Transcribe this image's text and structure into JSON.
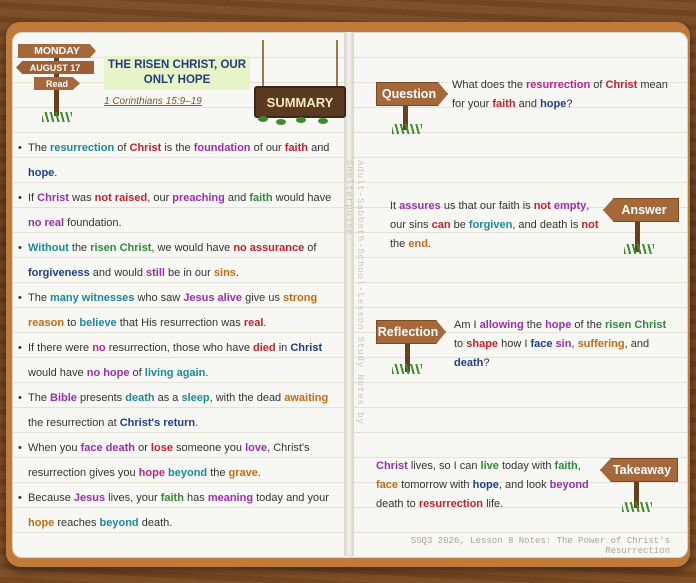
{
  "header": {
    "day": "MONDAY",
    "date": "AUGUST 17",
    "read": "Read",
    "title_line1": "THE RISEN CHRIST, OUR",
    "title_line2": "ONLY HOPE",
    "scripture": "1 Corinthians 15:9–19",
    "summary": "SUMMARY"
  },
  "summary_points": [
    [
      "The ",
      "resurrection",
      " of ",
      "Christ",
      " is the ",
      "foundation",
      " of our ",
      "faith",
      " and ",
      "hope",
      "."
    ],
    [
      "If ",
      "Christ",
      " was ",
      "not raised",
      ", our ",
      "preaching",
      " and ",
      "faith",
      " would have ",
      "no real",
      " foundation."
    ],
    [
      "",
      "Without",
      " the ",
      "risen Christ",
      ", we would have ",
      "no assurance",
      " of ",
      "forgiveness",
      " and would ",
      "still",
      " be in our ",
      "sins",
      "."
    ],
    [
      "The ",
      "many witnesses",
      " who saw ",
      "Jesus alive",
      " give us ",
      "strong reason",
      " to ",
      "believe",
      " that His resurrection was ",
      "real",
      "."
    ],
    [
      "If there were ",
      "no",
      " resurrection, those who have ",
      "died",
      " in ",
      "Christ",
      " would have ",
      "no hope",
      " of ",
      "living again",
      "."
    ],
    [
      "The ",
      "Bible",
      " presents ",
      "death",
      " as a ",
      "sleep",
      ", with the dead ",
      "awaiting",
      " the resurrection at ",
      "Christ's return",
      "."
    ],
    [
      "When you ",
      "face death",
      " or ",
      "lose",
      " someone you ",
      "love",
      ", Christ's resurrection gives you ",
      "hope",
      " ",
      "beyond",
      " the ",
      "grave",
      "."
    ],
    [
      "Because ",
      "Jesus",
      " lives, your ",
      "faith",
      " has ",
      "meaning",
      " today and your ",
      "hope",
      " reaches ",
      "beyond",
      " death."
    ]
  ],
  "question": {
    "label": "Question",
    "parts": [
      "What does the ",
      "resurrection",
      " of ",
      "Christ",
      " mean for your ",
      "faith",
      " and ",
      "hope",
      "?"
    ]
  },
  "answer": {
    "label": "Answer",
    "parts": [
      "It ",
      "assures",
      " us that our faith is ",
      "not",
      " ",
      "empty",
      ", our sins ",
      "can",
      " be ",
      "forgiven",
      ", and death is ",
      "not",
      " the ",
      "end",
      "."
    ]
  },
  "reflection": {
    "label": "Reflection",
    "parts": [
      "Am I ",
      "allowing",
      " the ",
      "hope",
      " of the ",
      "risen Christ",
      " to ",
      "shape",
      " how I ",
      "face",
      " ",
      "sin",
      ", ",
      "suffering",
      ", and ",
      "death",
      "?"
    ]
  },
  "takeaway": {
    "label": "Takeaway",
    "parts": [
      "",
      "Christ",
      " lives, so I can ",
      "live",
      " today with ",
      "faith",
      ", ",
      "face",
      " tomorrow with ",
      "hope",
      ", and look ",
      "beyond",
      " death to ",
      "resurrection",
      " life."
    ]
  },
  "vertical_credit": "Adult-Sabbath-School-Lesson Study Notes by Shelterpulse",
  "footer": "SSQ3 2026, Lesson 8 Notes: The Power of Christ's Resurrection",
  "colors": {
    "teal": "#1a8a9a",
    "red": "#c8202a",
    "purple": "#9b2fb0",
    "green": "#2f8a3a",
    "navy": "#1f3e8a",
    "orange": "#c86a14",
    "magenta": "#c5218a",
    "sign_wood": "#a5683a"
  }
}
